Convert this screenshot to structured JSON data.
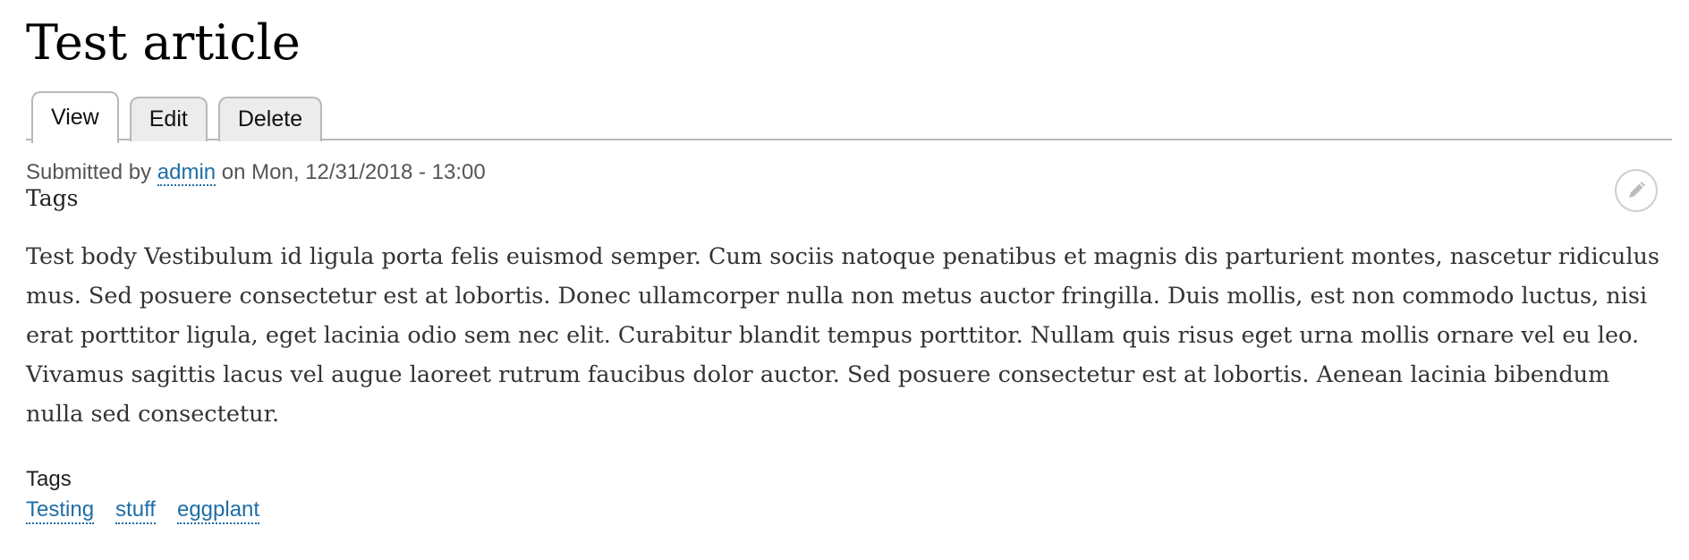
{
  "page": {
    "title": "Test article"
  },
  "tabs": [
    {
      "label": "View",
      "active": true
    },
    {
      "label": "Edit",
      "active": false
    },
    {
      "label": "Delete",
      "active": false
    }
  ],
  "meta": {
    "submitted_prefix": "Submitted by",
    "author": "admin",
    "date_prefix": "on",
    "date": "Mon, 12/31/2018 - 13:00"
  },
  "tags_heading": "Tags",
  "edit_icon": "pencil-icon",
  "body": "Test body Vestibulum id ligula porta felis euismod semper. Cum sociis natoque penatibus et magnis dis parturient montes, nascetur ridiculus mus. Sed posuere consectetur est at lobortis. Donec ullamcorper nulla non metus auctor fringilla. Duis mollis, est non commodo luctus, nisi erat porttitor ligula, eget lacinia odio sem nec elit. Curabitur blandit tempus porttitor. Nullam quis risus eget urna mollis ornare vel eu leo. Vivamus sagittis lacus vel augue laoreet rutrum faucibus dolor auctor. Sed posuere consectetur est at lobortis. Aenean lacinia bibendum nulla sed consectetur.",
  "tags_field": {
    "label": "Tags",
    "items": [
      "Testing",
      "stuff",
      "eggplant"
    ]
  },
  "colors": {
    "link": "#1f6ea6",
    "tab_border": "#b8b8b8",
    "tab_inactive_bg": "#ececec"
  }
}
